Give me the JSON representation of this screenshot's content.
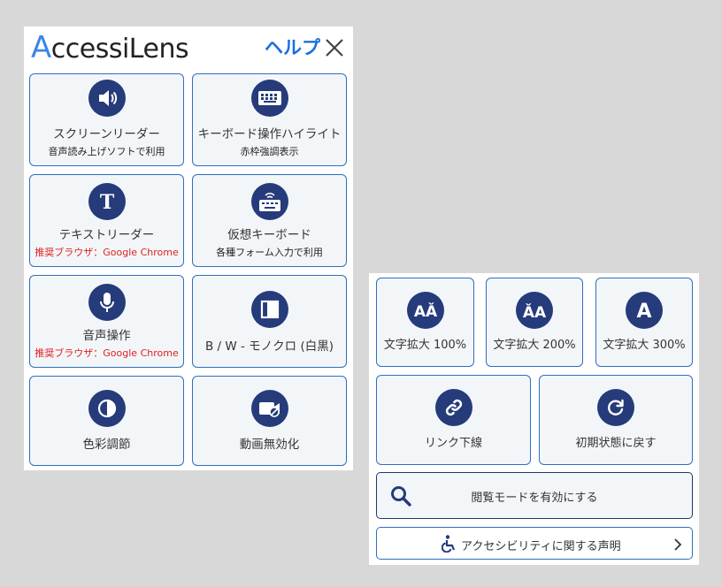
{
  "header": {
    "logo_first": "A",
    "logo_rest": "ccessiLens",
    "help_label": "ヘルプ"
  },
  "main_tiles": [
    {
      "label": "スクリーンリーダー",
      "sub": "音声読み上げソフトで利用",
      "icon": "speaker-icon"
    },
    {
      "label": "キーボード操作ハイライト",
      "sub": "赤枠強調表示",
      "icon": "keyboard-icon"
    },
    {
      "label": "テキストリーダー",
      "sub": "推奨ブラウザ：Google Chrome",
      "icon": "text-t-icon"
    },
    {
      "label": "仮想キーボード",
      "sub": "各種フォーム入力で利用",
      "icon": "virtual-keyboard-icon"
    },
    {
      "label": "音声操作",
      "sub": "推奨ブラウザ：Google Chrome",
      "icon": "microphone-icon"
    },
    {
      "label": "B / W - モノクロ (白黒)",
      "sub": "",
      "icon": "monochrome-icon"
    },
    {
      "label": "色彩調節",
      "sub": "",
      "icon": "contrast-icon"
    },
    {
      "label": "動画無効化",
      "sub": "",
      "icon": "video-off-icon"
    }
  ],
  "text_size_tiles": [
    {
      "label": "文字拡大 100%",
      "glyph": "AǍ"
    },
    {
      "label": "文字拡大 200%",
      "glyph": "ǍA"
    },
    {
      "label": "文字拡大 300%",
      "glyph": "A"
    }
  ],
  "link_tiles": [
    {
      "label": "リンク下線",
      "icon": "link-icon"
    },
    {
      "label": "初期状態に戻す",
      "icon": "reset-icon"
    }
  ],
  "browse_mode_label": "閲覧モードを有効にする",
  "accessibility_statement_label": "アクセシビリティに関する声明",
  "colors": {
    "navy": "#253b7a",
    "border_blue": "#2f6fbf",
    "help_blue": "#1a6fe0",
    "warn_red": "#e02020",
    "tile_bg": "#f3f6f9"
  }
}
